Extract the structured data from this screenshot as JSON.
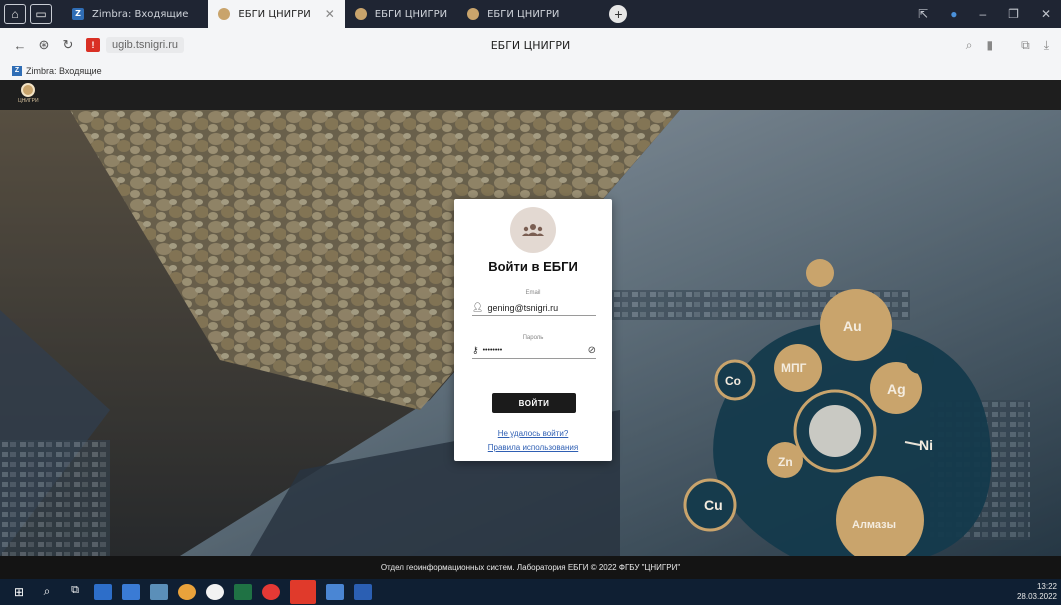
{
  "browser": {
    "tabs": [
      {
        "label": "Zimbra: Входящие",
        "active": false
      },
      {
        "label": "ЕБГИ ЦНИГРИ",
        "active": true
      },
      {
        "label": "ЕБГИ ЦНИГРИ",
        "active": false
      },
      {
        "label": "ЕБГИ ЦНИГРИ",
        "active": false
      }
    ],
    "new_tab": "+",
    "url": "ugib.tsnigri.ru",
    "page_title": "ЕБГИ ЦНИГРИ",
    "bookmark": "Zimbra: Входящие"
  },
  "site": {
    "logo_text": "ЦНИГРИ"
  },
  "login": {
    "title": "Войти в ЕБГИ",
    "email_label": "Email",
    "email_value": "gening@tsnigri.ru",
    "password_label": "Пароль",
    "password_value": "••••••••",
    "submit_label": "ВОЙТИ",
    "forgot_link": "Не удалось войти?",
    "rules_link": "Правила использования"
  },
  "elements": [
    "Au",
    "МПГ",
    "Co",
    "Ag",
    "Ni",
    "Zn",
    "Cu",
    "Алмазы"
  ],
  "footer": {
    "text": "Отдел геоинформационных систем. Лаборатория ЕБГИ © 2022 ФГБУ \"ЦНИГРИ\""
  },
  "taskbar": {
    "time": "13:22",
    "date": "28.03.2022"
  },
  "colors": {
    "accent_gold": "#c9a46c",
    "dark_teal": "#17465a",
    "link_blue": "#2f5fb3"
  }
}
